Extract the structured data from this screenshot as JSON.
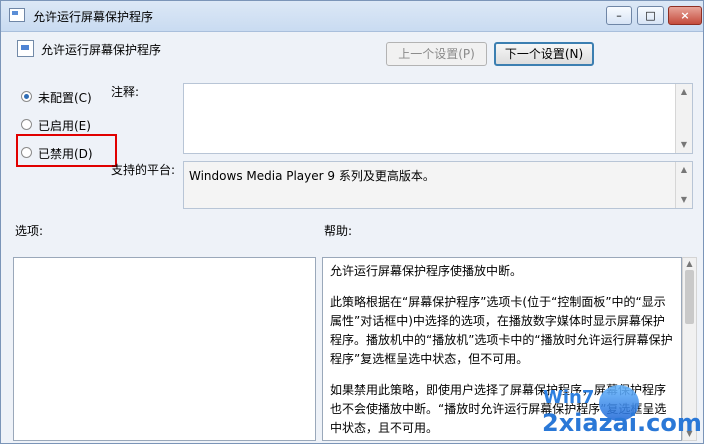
{
  "window": {
    "title": "允许运行屏幕保护程序",
    "minimize_glyph": "–",
    "maximize_glyph": "□",
    "close_glyph": "×"
  },
  "policy": {
    "name": "允许运行屏幕保护程序",
    "prev_button": "上一个设置(P)",
    "next_button": "下一个设置(N)"
  },
  "state": {
    "options": [
      {
        "label": "未配置(C)",
        "selected": true
      },
      {
        "label": "已启用(E)",
        "selected": false
      },
      {
        "label": "已禁用(D)",
        "selected": false
      }
    ],
    "highlight_color": "#e10000"
  },
  "fields": {
    "comment_label": "注释:",
    "comment_value": "",
    "platform_label": "支持的平台:",
    "platform_value": "Windows Media Player 9 系列及更高版本。"
  },
  "sections": {
    "options_label": "选项:",
    "help_label": "帮助:"
  },
  "help": {
    "paragraphs": [
      "允许运行屏幕保护程序使播放中断。",
      "此策略根据在“屏幕保护程序”选项卡(位于“控制面板”中的“显示属性”对话框中)中选择的选项，在播放数字媒体时显示屏幕保护程序。播放机中的“播放机”选项卡中的“播放时允许运行屏幕保护程序”复选框呈选中状态，但不可用。",
      "如果禁用此策略，即使用户选择了屏幕保护程序，屏幕保护程序也不会使播放中断。“播放时允许运行屏幕保护程序”复选框呈选中状态，且不可用。"
    ]
  },
  "watermark": {
    "brand": "Win7",
    "site": "2xiazai.com"
  },
  "icons": {
    "title_icon": "policy-settings-icon",
    "policy_icon": "policy-settings-icon"
  }
}
